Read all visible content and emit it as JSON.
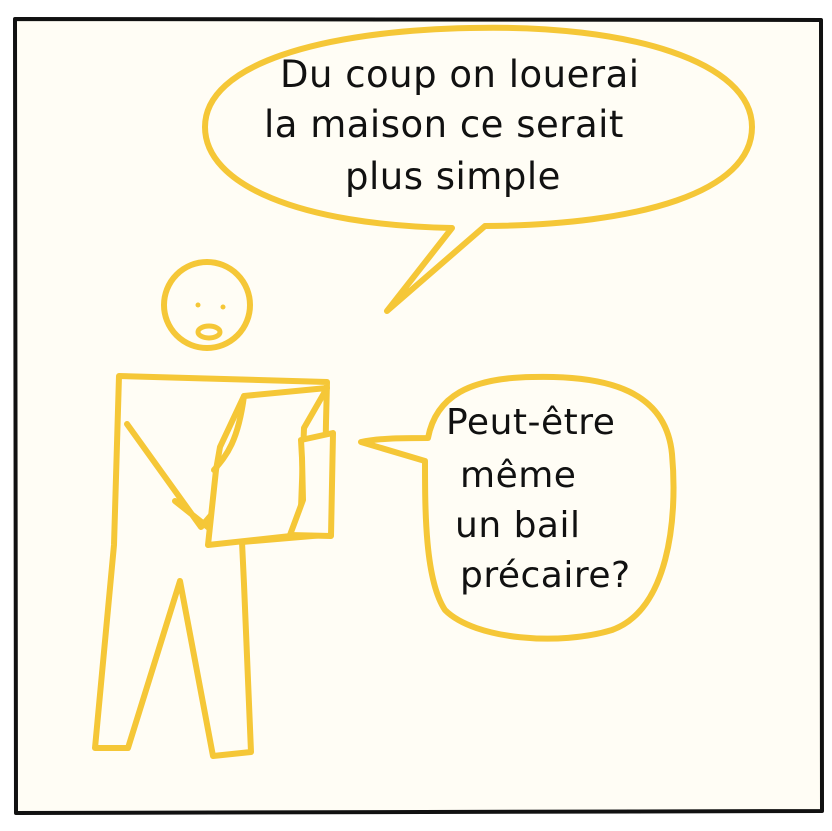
{
  "colors": {
    "background": "#fffdf5",
    "frame": "#111111",
    "stroke": "#f5c737",
    "text": "#111111"
  },
  "bubble_top": {
    "lines": [
      "Du coup on louerai",
      "la maison  ce serait",
      "plus  simple"
    ]
  },
  "bubble_right": {
    "lines": [
      "Peut-être",
      "même",
      "un bail",
      "précaire?"
    ]
  }
}
